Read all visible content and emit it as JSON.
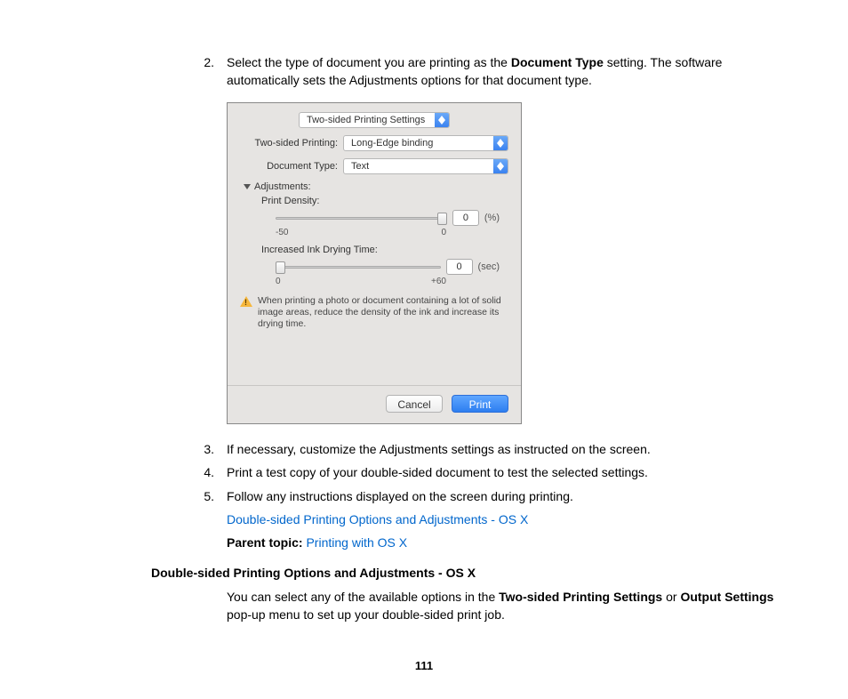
{
  "steps": {
    "s2": {
      "num": "2.",
      "text_a": "Select the type of document you are printing as the ",
      "text_b": "Document Type",
      "text_c": " setting. The software automatically sets the Adjustments options for that document type."
    },
    "s3": {
      "num": "3.",
      "text": "If necessary, customize the Adjustments settings as instructed on the screen."
    },
    "s4": {
      "num": "4.",
      "text": "Print a test copy of your double-sided document to test the selected settings."
    },
    "s5": {
      "num": "5.",
      "text": "Follow any instructions displayed on the screen during printing."
    }
  },
  "links": {
    "opts": "Double-sided Printing Options and Adjustments - OS X",
    "parent_label": "Parent topic: ",
    "parent_link": "Printing with OS X"
  },
  "section": {
    "heading": "Double-sided Printing Options and Adjustments - OS X",
    "body_a": "You can select any of the available options in the ",
    "body_b": "Two-sided Printing Settings",
    "body_c": " or ",
    "body_d": "Output Settings",
    "body_e": " pop-up menu to set up your double-sided print job."
  },
  "pagenum": "111",
  "dlg": {
    "topSelect": "Two-sided Printing Settings",
    "row1": {
      "label": "Two-sided Printing:",
      "value": "Long-Edge binding"
    },
    "row2": {
      "label": "Document Type:",
      "value": "Text"
    },
    "adjustments": "Adjustments:",
    "density": {
      "label": "Print Density:",
      "value": "0",
      "unit": "(%)",
      "min": "-50",
      "max": "0"
    },
    "drying": {
      "label": "Increased Ink Drying Time:",
      "value": "0",
      "unit": "(sec)",
      "min": "0",
      "max": "+60"
    },
    "warning": "When printing a photo or document containing a lot of solid image areas, reduce the density of the ink and increase its drying time.",
    "cancel": "Cancel",
    "print": "Print"
  }
}
